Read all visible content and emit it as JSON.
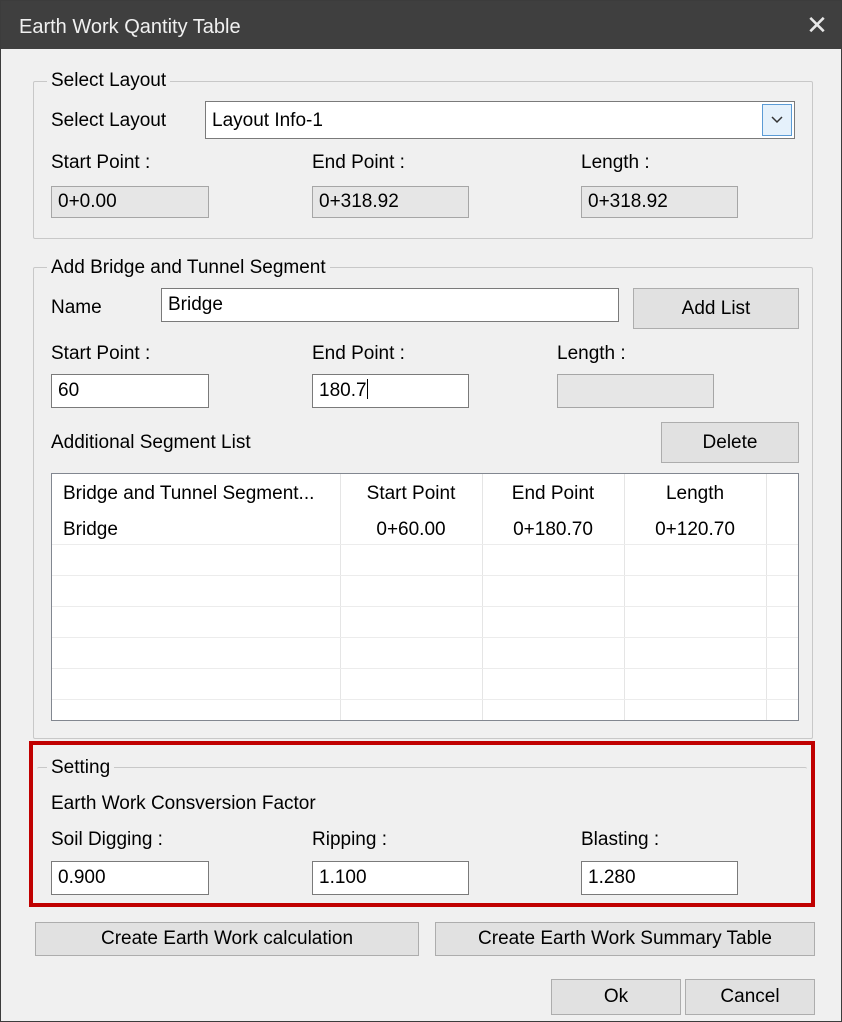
{
  "window": {
    "title": "Earth Work Qantity Table",
    "close_label": "✕"
  },
  "select_layout": {
    "group_title": "Select Layout",
    "layout_label": "Select Layout",
    "layout_value": "Layout Info-1",
    "start_label": "Start Point :",
    "start_value": "0+0.00",
    "end_label": "End Point :",
    "end_value": "0+318.92",
    "length_label": "Length :",
    "length_value": "0+318.92"
  },
  "segment": {
    "group_title": "Add Bridge and Tunnel Segment",
    "name_label": "Name",
    "name_value": "Bridge",
    "add_button": "Add List",
    "start_label": "Start Point :",
    "start_value": "60",
    "end_label": "End Point :",
    "end_value": "180.7",
    "length_label": "Length :",
    "length_value": "",
    "list_label": "Additional Segment List",
    "delete_button": "Delete",
    "columns": [
      "Bridge and Tunnel Segment...",
      "Start Point",
      "End Point",
      "Length"
    ],
    "rows": [
      {
        "name": "Bridge",
        "start": "0+60.00",
        "end": "0+180.70",
        "length": "0+120.70"
      }
    ]
  },
  "setting": {
    "group_title": "Setting",
    "subtitle": "Earth Work Consversion Factor",
    "soil_label": "Soil Digging :",
    "soil_value": "0.900",
    "ripping_label": "Ripping :",
    "ripping_value": "1.100",
    "blasting_label": "Blasting :",
    "blasting_value": "1.280"
  },
  "actions": {
    "calc_button": "Create Earth Work calculation",
    "summary_button": "Create Earth Work Summary Table",
    "ok_button": "Ok",
    "cancel_button": "Cancel"
  },
  "colors": {
    "titlebar": "#3f3f3f",
    "highlight": "#c00000",
    "dialog_bg": "#f0f0f0"
  }
}
